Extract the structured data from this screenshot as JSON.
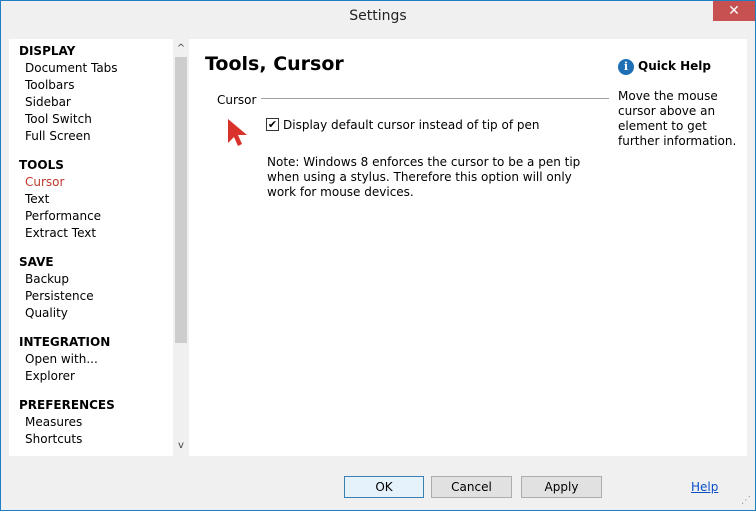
{
  "window": {
    "title": "Settings",
    "close_glyph": "✕"
  },
  "nav": {
    "groups": [
      {
        "heading": "DISPLAY",
        "items": [
          "Document Tabs",
          "Toolbars",
          "Sidebar",
          "Tool Switch",
          "Full Screen"
        ]
      },
      {
        "heading": "TOOLS",
        "items": [
          "Cursor",
          "Text",
          "Performance",
          "Extract Text"
        ]
      },
      {
        "heading": "SAVE",
        "items": [
          "Backup",
          "Persistence",
          "Quality"
        ]
      },
      {
        "heading": "INTEGRATION",
        "items": [
          "Open with...",
          "Explorer"
        ]
      },
      {
        "heading": "PREFERENCES",
        "items": [
          "Measures",
          "Shortcuts"
        ]
      }
    ],
    "active_item": "Cursor",
    "scroll_up_glyph": "^",
    "scroll_down_glyph": "v"
  },
  "content": {
    "title": "Tools, Cursor",
    "section_label": "Cursor",
    "checkbox_label": "Display default cursor instead of tip of pen",
    "checkbox_checked": true,
    "check_glyph": "✔",
    "note": "Note: Windows 8 enforces the cursor to be a pen tip when using a stylus. Therefore this option will only work for mouse devices."
  },
  "help": {
    "icon_glyph": "i",
    "title": "Quick Help",
    "text": "Move the mouse cursor above an element to get further information."
  },
  "footer": {
    "ok_label": "OK",
    "cancel_label": "Cancel",
    "apply_label": "Apply",
    "help_link": "Help",
    "grip_glyph": "⋰"
  },
  "colors": {
    "active_nav": "#c0392b",
    "cursor_arrow": "#d9322a",
    "info_icon": "#1f6fb5",
    "link": "#0b4fc7"
  }
}
